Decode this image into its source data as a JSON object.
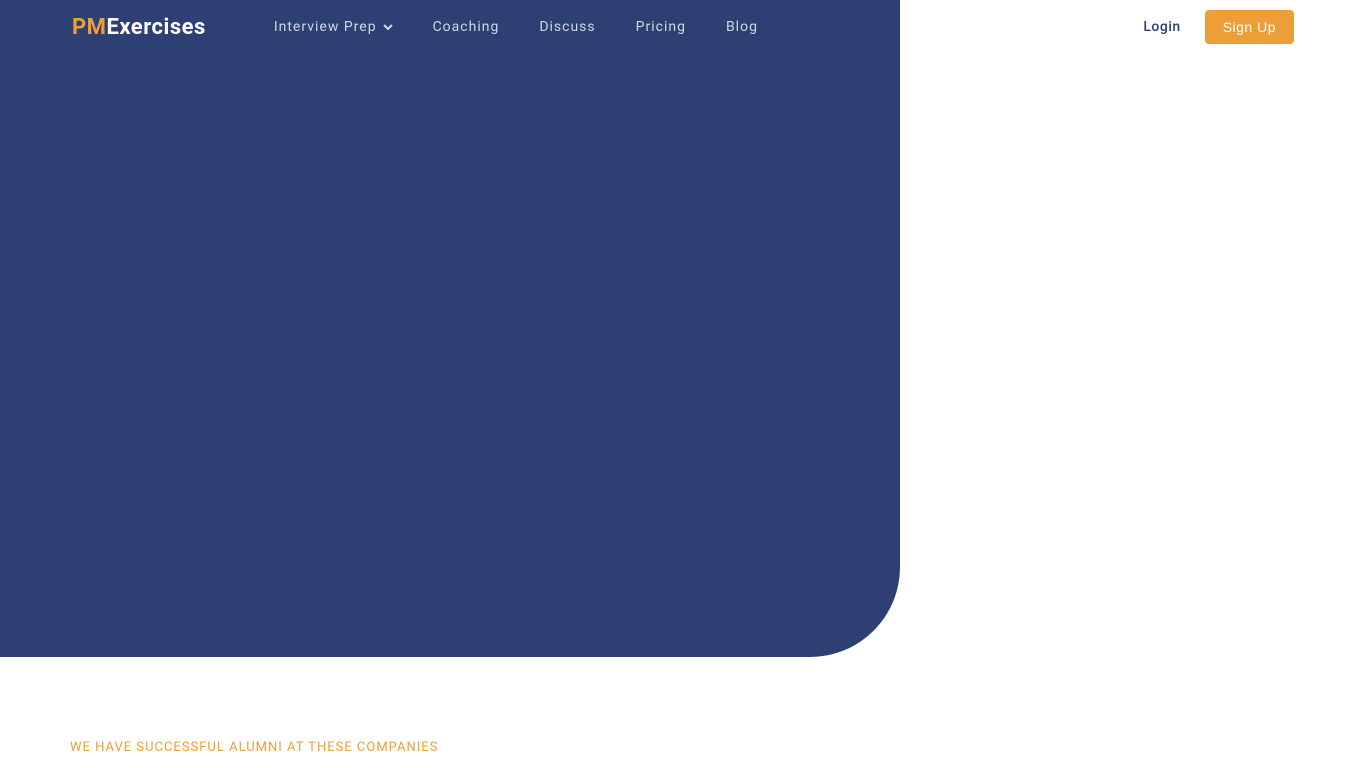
{
  "logo": {
    "pm": "PM",
    "exercises": "Exercises"
  },
  "nav": {
    "items": [
      {
        "label": "Interview Prep",
        "hasDropdown": true
      },
      {
        "label": "Coaching",
        "hasDropdown": false
      },
      {
        "label": "Discuss",
        "hasDropdown": false
      },
      {
        "label": "Pricing",
        "hasDropdown": false
      },
      {
        "label": "Blog",
        "hasDropdown": false
      }
    ]
  },
  "auth": {
    "login": "Login",
    "signup": "Sign Up"
  },
  "alumni": {
    "heading": "WE HAVE SUCCESSFUL ALUMNI AT THESE COMPANIES"
  },
  "colors": {
    "navy": "#2e3f73",
    "orange": "#ee9e36",
    "white": "#ffffff"
  }
}
